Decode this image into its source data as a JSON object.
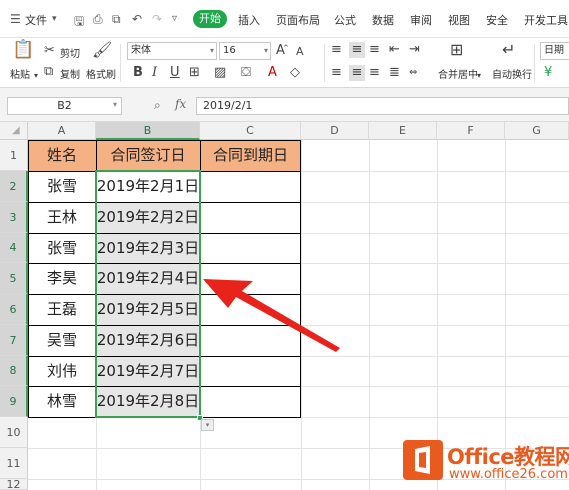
{
  "menubar": {
    "file_label": "文件",
    "tabs": [
      {
        "label": "开始",
        "active": true
      },
      {
        "label": "插入"
      },
      {
        "label": "页面布局"
      },
      {
        "label": "公式"
      },
      {
        "label": "数据"
      },
      {
        "label": "审阅"
      },
      {
        "label": "视图"
      },
      {
        "label": "安全"
      },
      {
        "label": "开发工具"
      }
    ]
  },
  "ribbon": {
    "paste_label": "粘贴",
    "cut_label": "剪切",
    "copy_label": "复制",
    "format_painter_label": "格式刷",
    "font_name": "宋体",
    "font_size": "16",
    "grow_font": "A",
    "shrink_font": "A",
    "bold": "B",
    "italic": "I",
    "underline": "U",
    "merge_center_label": "合并居中",
    "wrap_text_label": "自动换行",
    "number_format": "日期"
  },
  "formula_bar": {
    "name_box": "B2",
    "fx_label": "fx",
    "value": "2019/2/1"
  },
  "sheet": {
    "columns": [
      "A",
      "B",
      "C",
      "D",
      "E",
      "F",
      "G"
    ],
    "rows": [
      "1",
      "2",
      "3",
      "4",
      "5",
      "6",
      "7",
      "8",
      "9",
      "10",
      "11",
      "12"
    ],
    "header": [
      "姓名",
      "合同签订日",
      "合同到期日"
    ],
    "data": [
      [
        "张雪",
        "2019年2月1日",
        ""
      ],
      [
        "王林",
        "2019年2月2日",
        ""
      ],
      [
        "张雪",
        "2019年2月3日",
        ""
      ],
      [
        "李昊",
        "2019年2月4日",
        ""
      ],
      [
        "王磊",
        "2019年2月5日",
        ""
      ],
      [
        "吴雪",
        "2019年2月6日",
        ""
      ],
      [
        "刘伟",
        "2019年2月7日",
        ""
      ],
      [
        "林雪",
        "2019年2月8日",
        ""
      ]
    ],
    "header_fill": "#f4b183",
    "selection_color": "#3aa155"
  },
  "watermark": {
    "brand": "Office教程网",
    "url": "www.office26.com"
  },
  "colors": {
    "accent": "#1fa84b",
    "arrow": "#e8231c",
    "logo": "#e85a1d"
  }
}
